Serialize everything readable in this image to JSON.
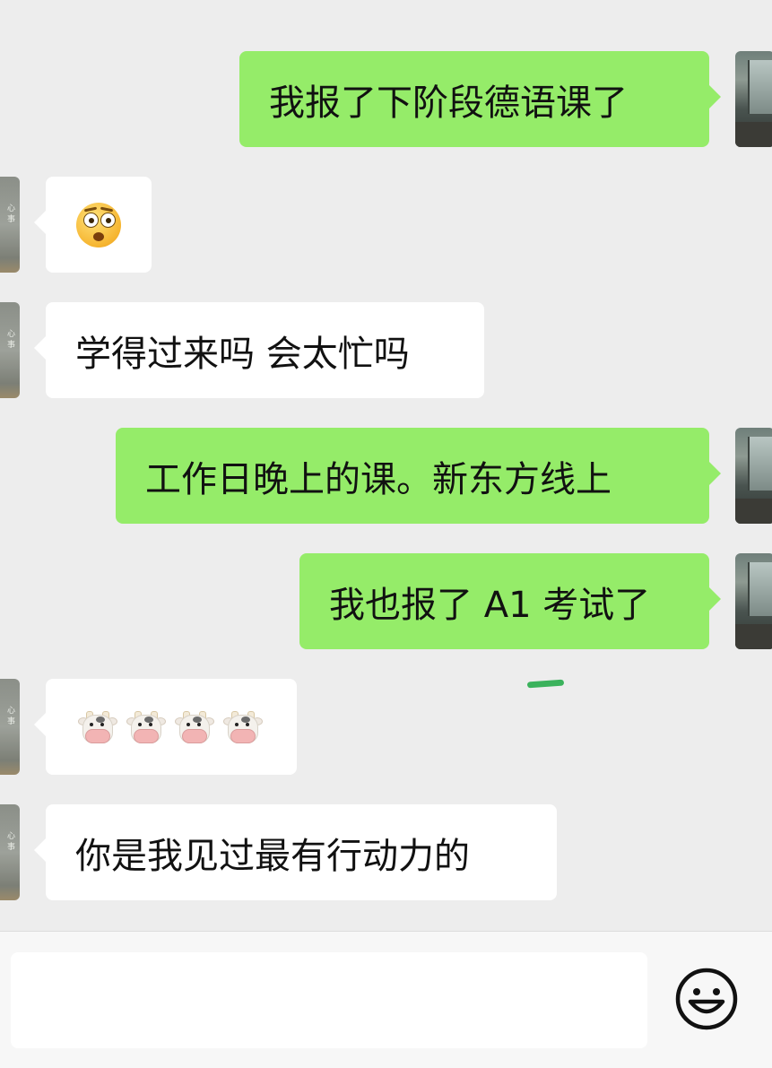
{
  "messages": [
    {
      "side": "out",
      "type": "text",
      "text": "我报了下阶段德语课了"
    },
    {
      "side": "in",
      "type": "emoji",
      "emoji": "flushed-face"
    },
    {
      "side": "in",
      "type": "text",
      "text": "学得过来吗 会太忙吗"
    },
    {
      "side": "out",
      "type": "text",
      "text": "工作日晚上的课。新东方线上"
    },
    {
      "side": "out",
      "type": "text",
      "text": "我也报了 A1 考试了"
    },
    {
      "side": "in",
      "type": "emoji",
      "emoji": "cow-face",
      "count": 4
    },
    {
      "side": "in",
      "type": "text",
      "text": "你是我见过最有行动力的"
    }
  ],
  "colors": {
    "chat_background": "#ededed",
    "outgoing_bubble": "#95ec69",
    "incoming_bubble": "#ffffff",
    "input_bar": "#f7f7f7"
  },
  "input": {
    "value": "",
    "emoji_button_icon": "smiley-icon"
  }
}
